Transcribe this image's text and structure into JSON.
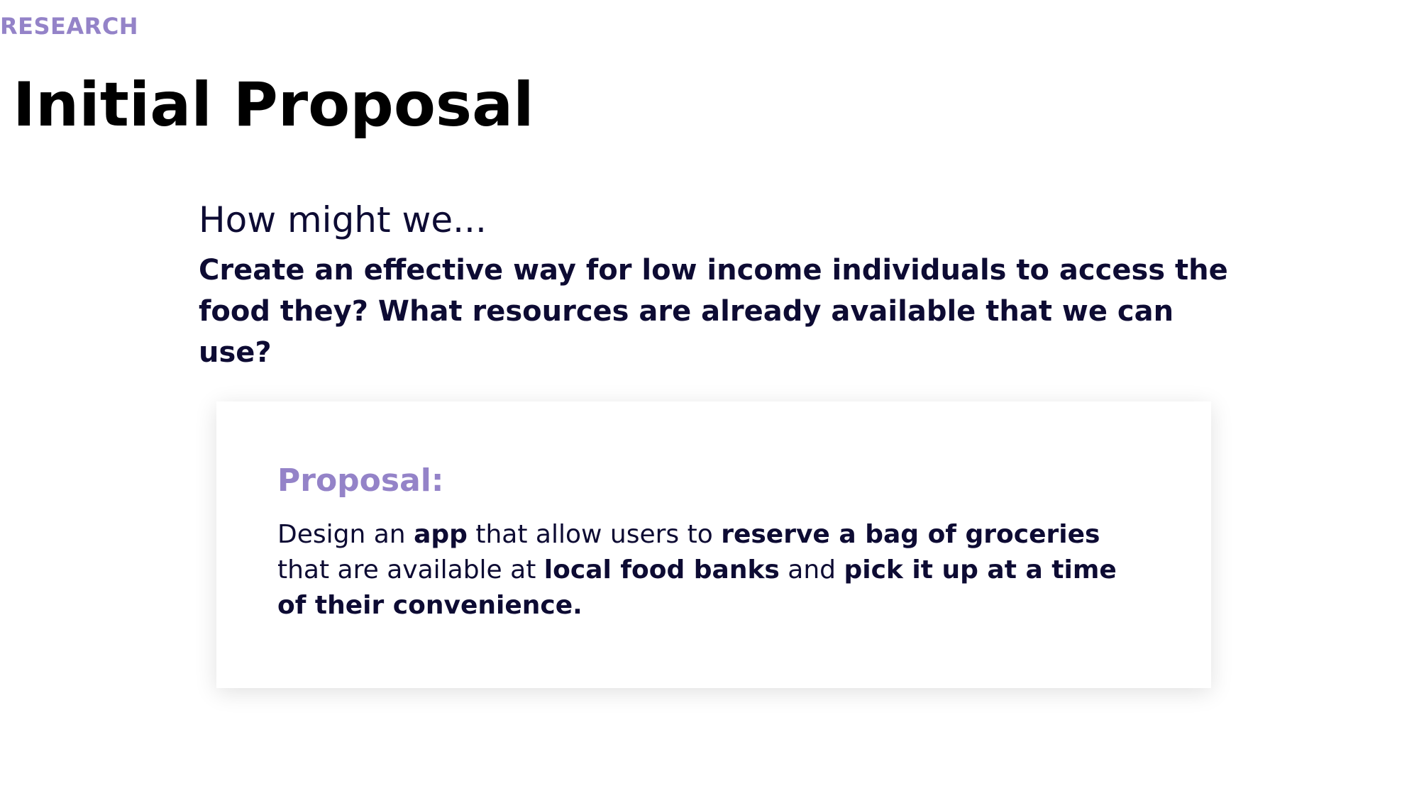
{
  "section_label": "RESEARCH",
  "title": "Initial Proposal",
  "hmw": {
    "intro": "How might we...",
    "question": "Create an effective way for low income individuals to access the food they? What resources are already available that we can use?"
  },
  "proposal": {
    "heading": "Proposal:",
    "segments": [
      {
        "text": "Design an ",
        "bold": false
      },
      {
        "text": "app",
        "bold": true
      },
      {
        "text": " that allow users to ",
        "bold": false
      },
      {
        "text": "reserve a bag of groceries",
        "bold": true
      },
      {
        "text": " that are available at ",
        "bold": false
      },
      {
        "text": "local food banks",
        "bold": true
      },
      {
        "text": " and ",
        "bold": false
      },
      {
        "text": "pick it up at a time of their convenience.",
        "bold": true
      }
    ]
  },
  "colors": {
    "accent": "#9483c8",
    "text_dark": "#0d0b33",
    "title": "#000000"
  }
}
